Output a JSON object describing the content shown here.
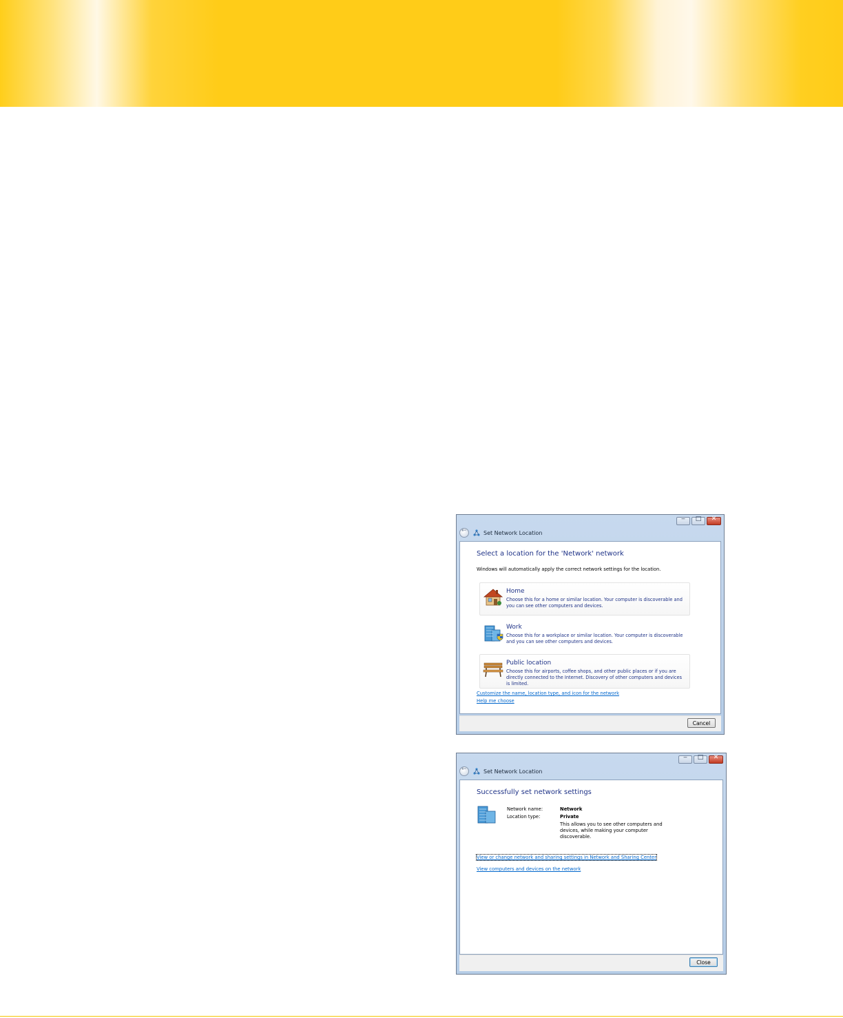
{
  "window1": {
    "title": "Set Network Location",
    "heading": "Select a location for the 'Network' network",
    "intro": "Windows will automatically apply the correct network settings for the location.",
    "options": [
      {
        "title": "Home",
        "description": "Choose this for a home or similar location. Your computer is discoverable and you can see other computers and devices.",
        "icon": "house-icon"
      },
      {
        "title": "Work",
        "description": "Choose this for a workplace or similar location. Your computer is discoverable and you can see other computers and devices.",
        "icon": "office-building-icon"
      },
      {
        "title": "Public location",
        "description": "Choose this for airports, coffee shops, and other public places or if you are directly connected to the Internet. Discovery of other computers and devices is limited.",
        "icon": "park-bench-icon"
      }
    ],
    "links": [
      "Customize the name, location type, and icon for the network",
      "Help me choose"
    ],
    "cancel_label": "Cancel"
  },
  "window2": {
    "title": "Set Network Location",
    "heading": "Successfully set network settings",
    "network_name_label": "Network name:",
    "network_name_value": "Network",
    "location_type_label": "Location type:",
    "location_type_value": "Private",
    "location_description": "This allows you to see other computers and devices, while making your computer discoverable.",
    "links": [
      "View or change network and sharing settings in Network and Sharing Center",
      "View computers and devices on the network"
    ],
    "close_label": "Close"
  },
  "caption_buttons": {
    "minimize": "‒",
    "maximize": "□",
    "close": "✕"
  },
  "colors": {
    "banner": "#ffcc18",
    "link": "#0066cc",
    "heading": "#1e3287"
  }
}
